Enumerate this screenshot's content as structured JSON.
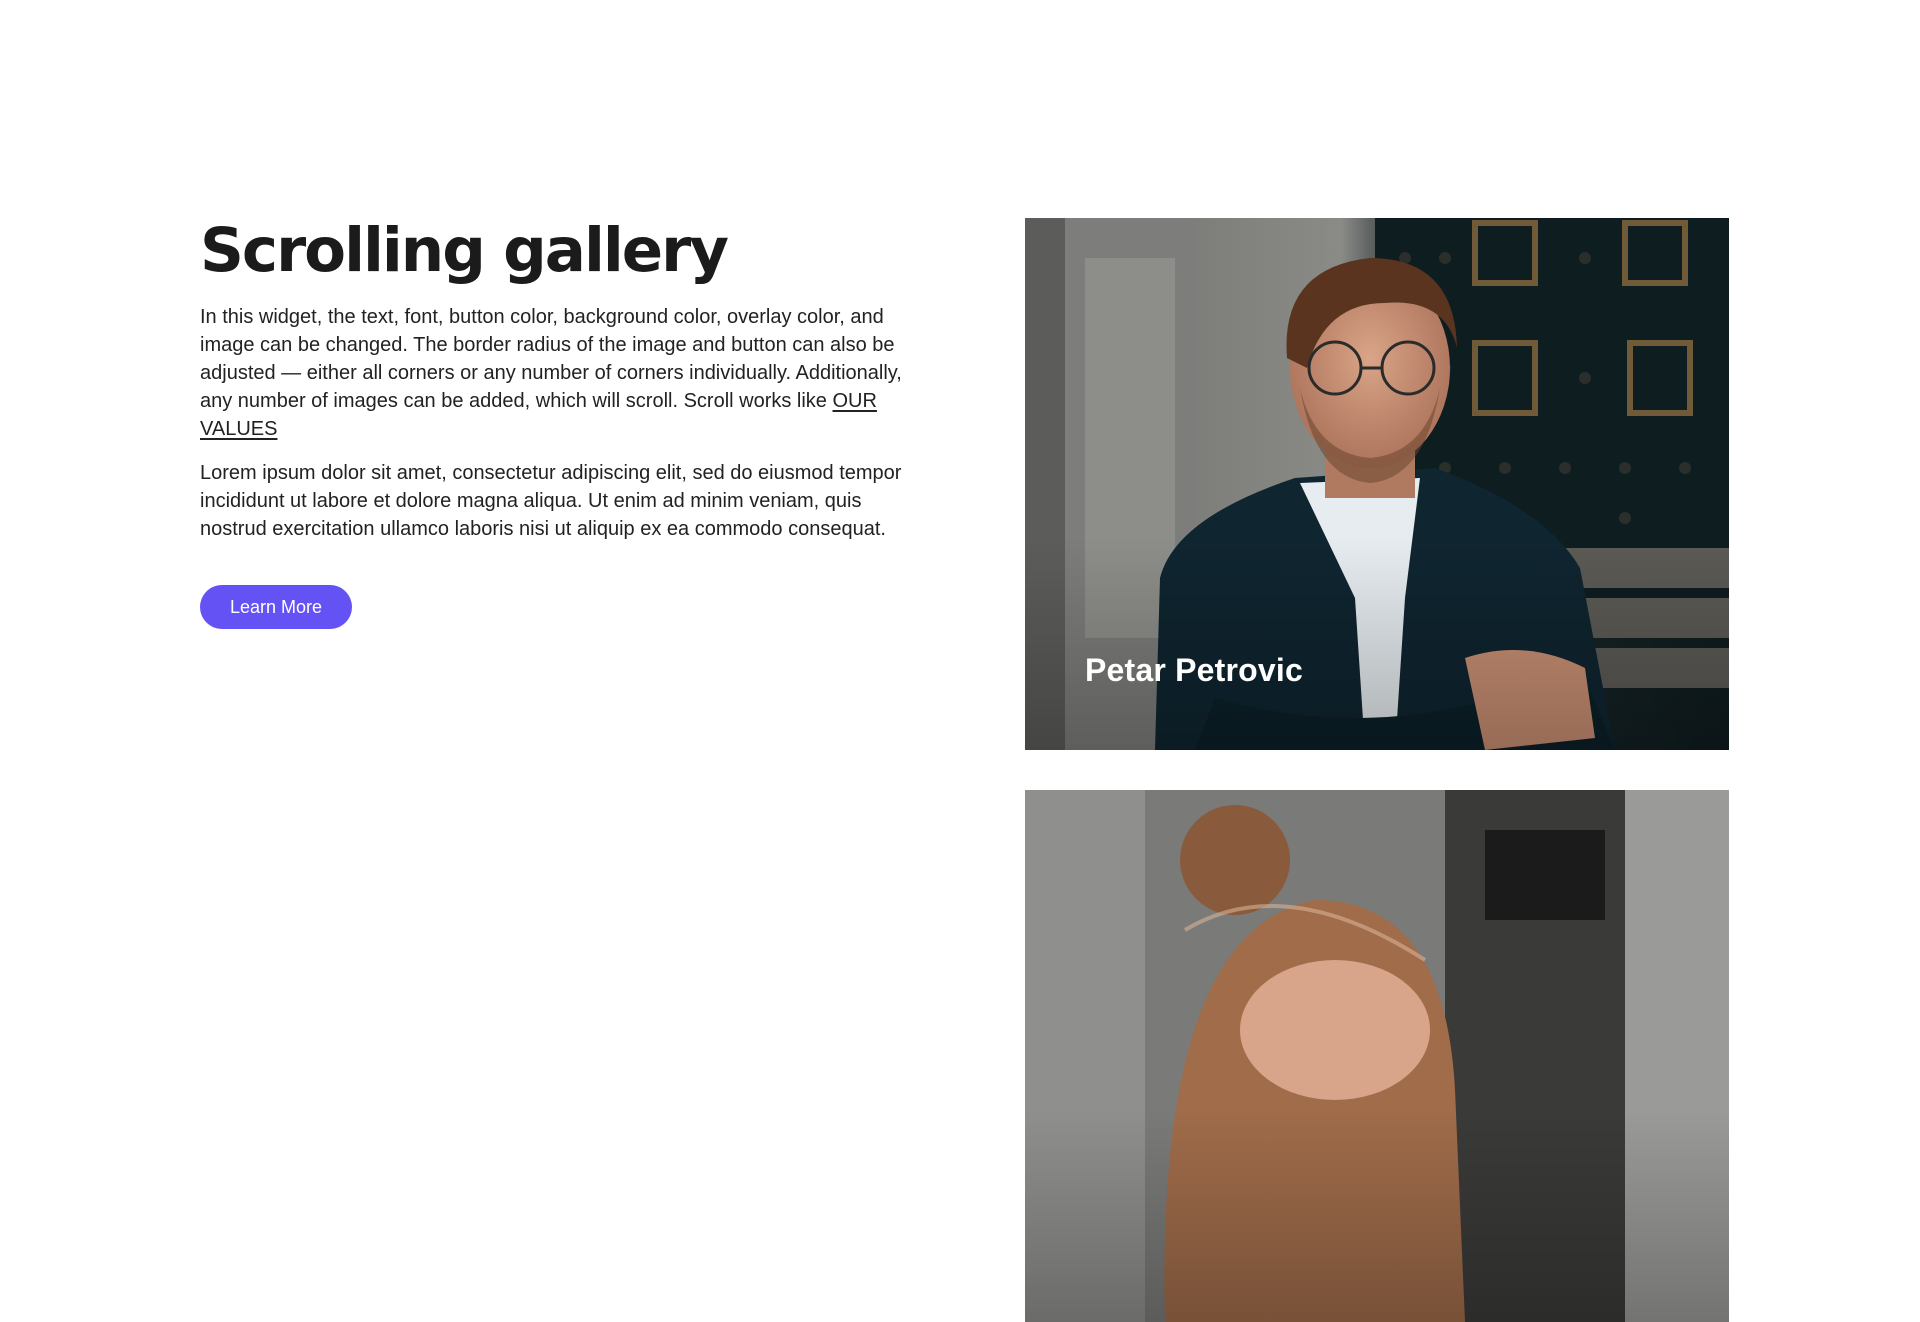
{
  "hero": {
    "title": "Scrolling gallery",
    "paragraph1_text": "In this widget, the text, font, button color, background color, overlay color, and image can be changed. The border radius of the image and button can also be adjusted — either all corners or any number of corners individually. Additionally, any number of images can be added, which will scroll. Scroll works like ",
    "paragraph1_link": "OUR VALUES",
    "paragraph2": "Lorem ipsum dolor sit amet, consectetur adipiscing elit, sed do eiusmod tempor incididunt ut labore et dolore magna aliqua. Ut enim ad minim veniam, quis nostrud exercitation ullamco laboris nisi ut aliquip ex ea commodo consequat.",
    "button_label": "Learn More"
  },
  "gallery": {
    "items": [
      {
        "name": "Petar Petrovic"
      },
      {
        "name": ""
      }
    ]
  },
  "colors": {
    "accent": "#6552f5",
    "text": "#1d1d1f",
    "background": "#ffffff"
  }
}
